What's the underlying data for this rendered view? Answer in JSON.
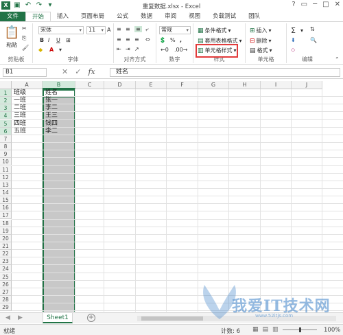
{
  "titlebar": {
    "title": "重复数据.xlsx - Excel",
    "logo": "X"
  },
  "tabs": [
    "文件",
    "开始",
    "插入",
    "页面布局",
    "公式",
    "数据",
    "审阅",
    "视图",
    "负载测试",
    "团队"
  ],
  "ribbon": {
    "clipboard": {
      "label": "剪贴板",
      "paste": "粘贴"
    },
    "font": {
      "label": "字体",
      "font_name": "宋体",
      "font_size": "11",
      "bold": "B",
      "italic": "I",
      "underline": "U",
      "font_color_letter": "A",
      "bigger": "A",
      "smaller": "A"
    },
    "alignment": {
      "label": "对齐方式"
    },
    "number": {
      "label": "数字",
      "format": "常规",
      "percent": "%",
      "comma": ","
    },
    "styles": {
      "label": "样式",
      "conditional": "条件格式",
      "table_format": "套用表格格式",
      "cell_styles": "单元格样式"
    },
    "cells": {
      "label": "单元格",
      "insert": "插入",
      "delete": "删除",
      "format": "格式"
    },
    "editing": {
      "label": "编辑",
      "sum": "Σ"
    }
  },
  "formula_bar": {
    "name_box": "B1",
    "content": "姓名",
    "fx": "fx"
  },
  "grid": {
    "columns": [
      "A",
      "B",
      "C",
      "D",
      "E",
      "F",
      "G",
      "H",
      "I",
      "J"
    ],
    "rows": [
      "1",
      "2",
      "3",
      "4",
      "5",
      "6",
      "7",
      "8",
      "9",
      "10",
      "11",
      "12",
      "13",
      "14",
      "15",
      "16",
      "17",
      "18",
      "19",
      "20",
      "21",
      "22",
      "23",
      "24",
      "25",
      "26",
      "27",
      "28",
      "29"
    ],
    "col_a": [
      "班级",
      "一班",
      "二班",
      "三班",
      "四班",
      "五班"
    ],
    "col_b": [
      "姓名",
      "张一",
      "李二",
      "王三",
      "钱四",
      "李二"
    ]
  },
  "sheets": {
    "tabs": [
      "Sheet1"
    ],
    "add": "+"
  },
  "status": {
    "ready": "就绪",
    "count": "计数: 6",
    "zoom": "100%"
  },
  "watermark": {
    "text": "我爱IT技术网",
    "sub": "www.52itjs.com"
  },
  "colors": {
    "excel_green": "#217346",
    "highlight": "#e23b3b",
    "selection": "#c8c8c8"
  }
}
